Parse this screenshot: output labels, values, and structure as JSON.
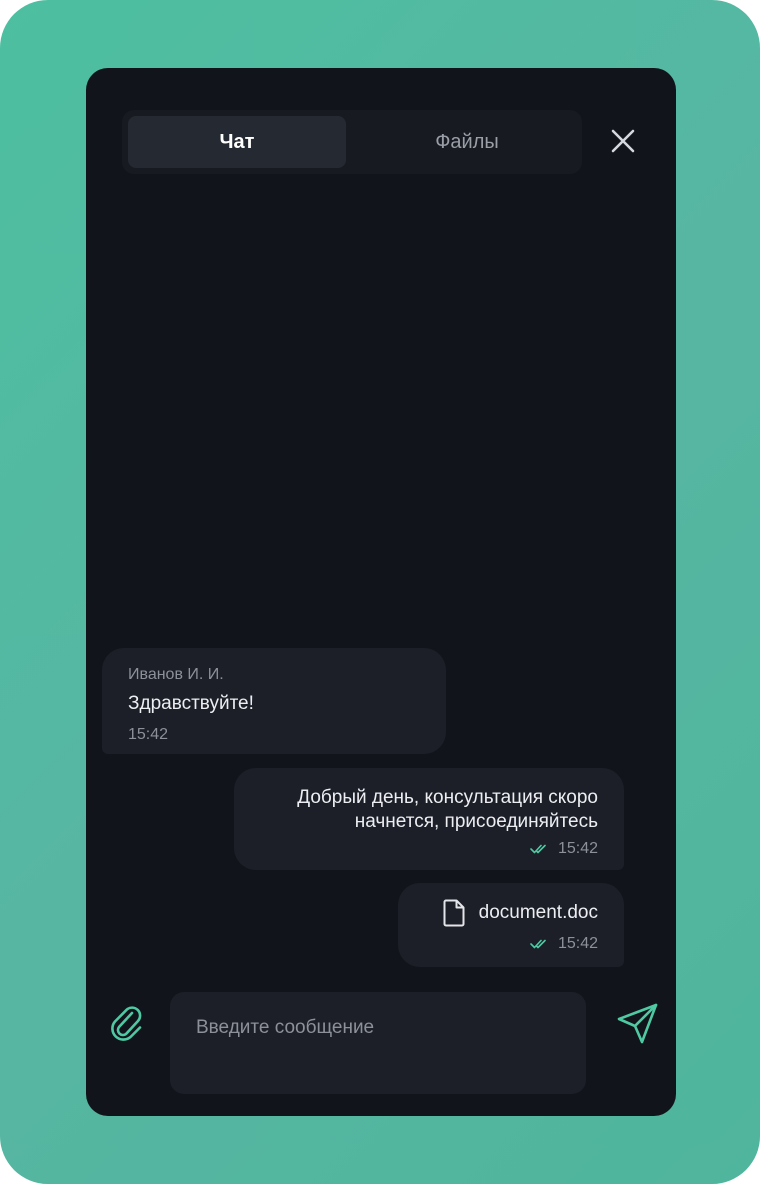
{
  "tabs": [
    {
      "label": "Чат",
      "active": true
    },
    {
      "label": "Файлы",
      "active": false
    }
  ],
  "icons": {
    "close": "close-icon",
    "attach": "paperclip-icon",
    "send": "send-icon",
    "file": "file-icon",
    "read": "double-check-icon"
  },
  "messages": [
    {
      "direction": "incoming",
      "sender": "Иванов И. И.",
      "text": "Здравствуйте!",
      "time": "15:42"
    },
    {
      "direction": "outgoing",
      "text_line1": "Добрый день, консультация скоро",
      "text_line2": "начнется, присоединяйтесь",
      "time": "15:42",
      "status": "read"
    },
    {
      "direction": "outgoing",
      "file_name": "document.doc",
      "time": "15:42",
      "status": "read"
    }
  ],
  "composer": {
    "placeholder": "Введите сообщение",
    "value": ""
  },
  "colors": {
    "accent": "#4ec9a2",
    "panel_bg": "#12141b",
    "bubble_bg": "#1c1f27",
    "backdrop": "#4dbfa0"
  }
}
